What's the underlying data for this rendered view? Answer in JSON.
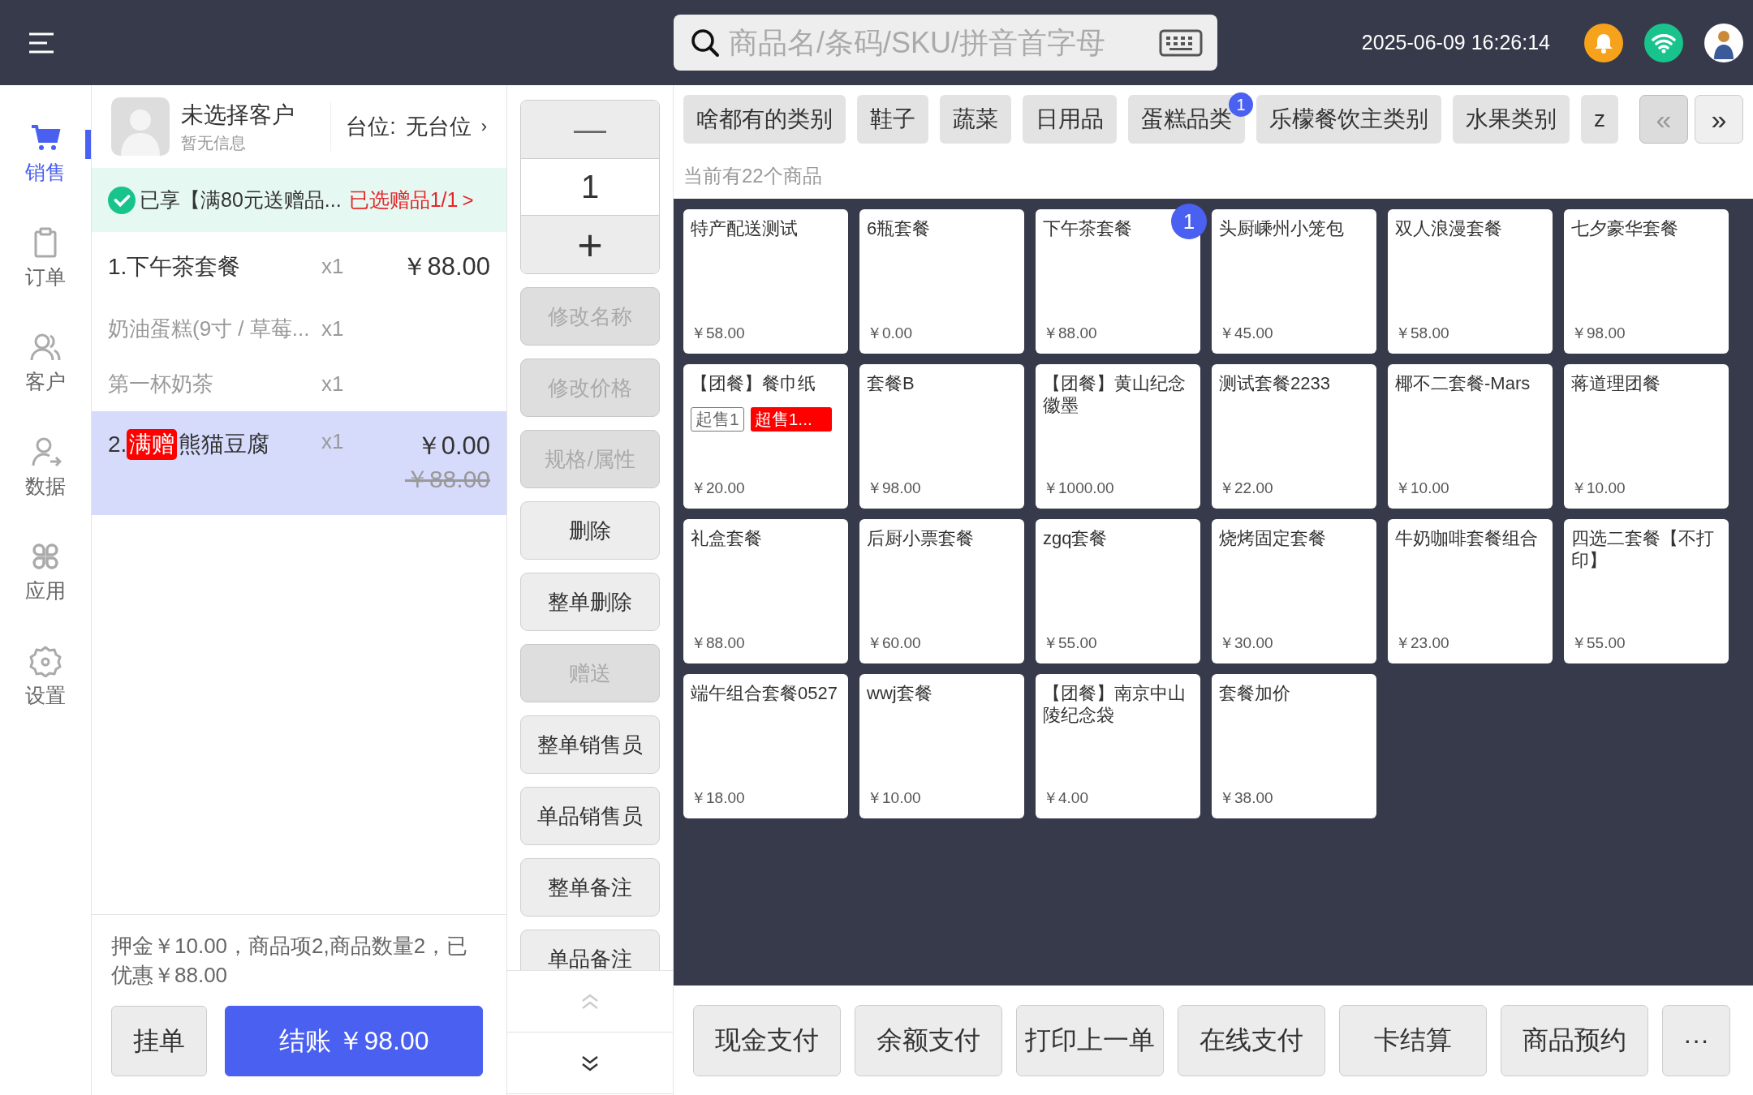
{
  "top_bar": {
    "search": {
      "placeholder": "商品名/条码/SKU/拼音首字母"
    },
    "datetime": "2025-06-09 16:26:14"
  },
  "nav": [
    {
      "label": "销售",
      "selected": true
    },
    {
      "label": "订单",
      "selected": false
    },
    {
      "label": "客户",
      "selected": false
    },
    {
      "label": "数据",
      "selected": false
    },
    {
      "label": "应用",
      "selected": false
    },
    {
      "label": "设置",
      "selected": false
    }
  ],
  "customer": {
    "name": "未选择客户",
    "info": "暂无信息",
    "table_label": "台位:",
    "table_value": "无台位",
    "arrow": "›"
  },
  "promo": {
    "text": "已享【满80元送赠品...",
    "gift_status": "已选赠品1/1",
    "arrow": ">"
  },
  "cart_items": [
    {
      "index": "1.",
      "name": "下午茶套餐",
      "qty": "x1",
      "price": "￥88.00",
      "selected": false,
      "children": [
        {
          "name": "奶油蛋糕(9寸 / 草莓...",
          "qty": "x1"
        },
        {
          "name": "第一杯奶茶",
          "qty": "x1"
        }
      ]
    },
    {
      "index": "2.",
      "tag": "满赠",
      "name": "熊猫豆腐",
      "qty": "x1",
      "price": "￥0.00",
      "original_price": "￥88.00",
      "selected": true
    }
  ],
  "summary": "押金￥10.00，商品项2,商品数量2，已优惠￥88.00",
  "footer_buttons": [
    {
      "label": "挂单",
      "kind": "secondary"
    },
    {
      "label": "结账 ￥98.00",
      "kind": "primary"
    }
  ],
  "quantity": {
    "minus": "—",
    "value": "1",
    "plus": "+"
  },
  "actions": [
    {
      "label": "修改名称",
      "disabled": true
    },
    {
      "label": "修改价格",
      "disabled": true
    },
    {
      "label": "规格/属性",
      "disabled": true
    },
    {
      "label": "删除",
      "disabled": false
    },
    {
      "label": "整单删除",
      "disabled": false
    },
    {
      "label": "赠送",
      "disabled": true
    },
    {
      "label": "整单销售员",
      "disabled": false
    },
    {
      "label": "单品销售员",
      "disabled": false
    },
    {
      "label": "整单备注",
      "disabled": false
    },
    {
      "label": "单品备注",
      "disabled": false
    }
  ],
  "action_scroll": {
    "up_disabled": true,
    "down_disabled": false
  },
  "categories": [
    {
      "label": "啥都有的类别",
      "selected": false
    },
    {
      "label": "鞋子",
      "selected": false
    },
    {
      "label": "蔬菜",
      "selected": false
    },
    {
      "label": "日用品",
      "selected": false
    },
    {
      "label": "蛋糕品类",
      "badge": "1",
      "selected": false
    },
    {
      "label": "乐檬餐饮主类别",
      "selected": false
    },
    {
      "label": "水果类别",
      "selected": false
    },
    {
      "label": "z",
      "selected": false
    }
  ],
  "category_nav": {
    "prev": "«",
    "next": "»",
    "prev_disabled": true
  },
  "product_count": "当前有22个商品",
  "products": [
    {
      "name": "特产配送测试",
      "price": "￥58.00"
    },
    {
      "name": "6瓶套餐",
      "price": "￥0.00"
    },
    {
      "name": "下午茶套餐",
      "price": "￥88.00",
      "badge": "1"
    },
    {
      "name": "头厨嵊州小笼包",
      "price": "￥45.00"
    },
    {
      "name": "双人浪漫套餐",
      "price": "￥58.00"
    },
    {
      "name": "七夕豪华套餐",
      "price": "￥98.00"
    },
    {
      "name": "【团餐】餐巾纸",
      "price": "￥20.00",
      "tags": [
        {
          "text": "起售1",
          "kind": "outline"
        },
        {
          "text": "超售1...",
          "kind": "alert"
        }
      ]
    },
    {
      "name": "套餐B",
      "price": "￥98.00"
    },
    {
      "name": "【团餐】黄山纪念徽墨",
      "price": "￥1000.00"
    },
    {
      "name": "测试套餐2233",
      "price": "￥22.00"
    },
    {
      "name": "椰不二套餐-Mars",
      "price": "￥10.00"
    },
    {
      "name": "蒋道理团餐",
      "price": "￥10.00"
    },
    {
      "name": "礼盒套餐",
      "price": "￥88.00"
    },
    {
      "name": "后厨小票套餐",
      "price": "￥60.00"
    },
    {
      "name": "zgq套餐",
      "price": "￥55.00"
    },
    {
      "name": "烧烤固定套餐",
      "price": "￥30.00"
    },
    {
      "name": "牛奶咖啡套餐组合",
      "price": "￥23.00"
    },
    {
      "name": "四选二套餐【不打印】",
      "price": "￥55.00"
    },
    {
      "name": "端午组合套餐0527",
      "price": "￥18.00"
    },
    {
      "name": "wwj套餐",
      "price": "￥10.00"
    },
    {
      "name": "【团餐】南京中山陵纪念袋",
      "price": "￥4.00"
    },
    {
      "name": "套餐加价",
      "price": "￥38.00"
    }
  ],
  "pay_buttons": [
    "现金支付",
    "余额支付",
    "打印上一单",
    "在线支付",
    "卡结算",
    "商品预约",
    "···"
  ]
}
